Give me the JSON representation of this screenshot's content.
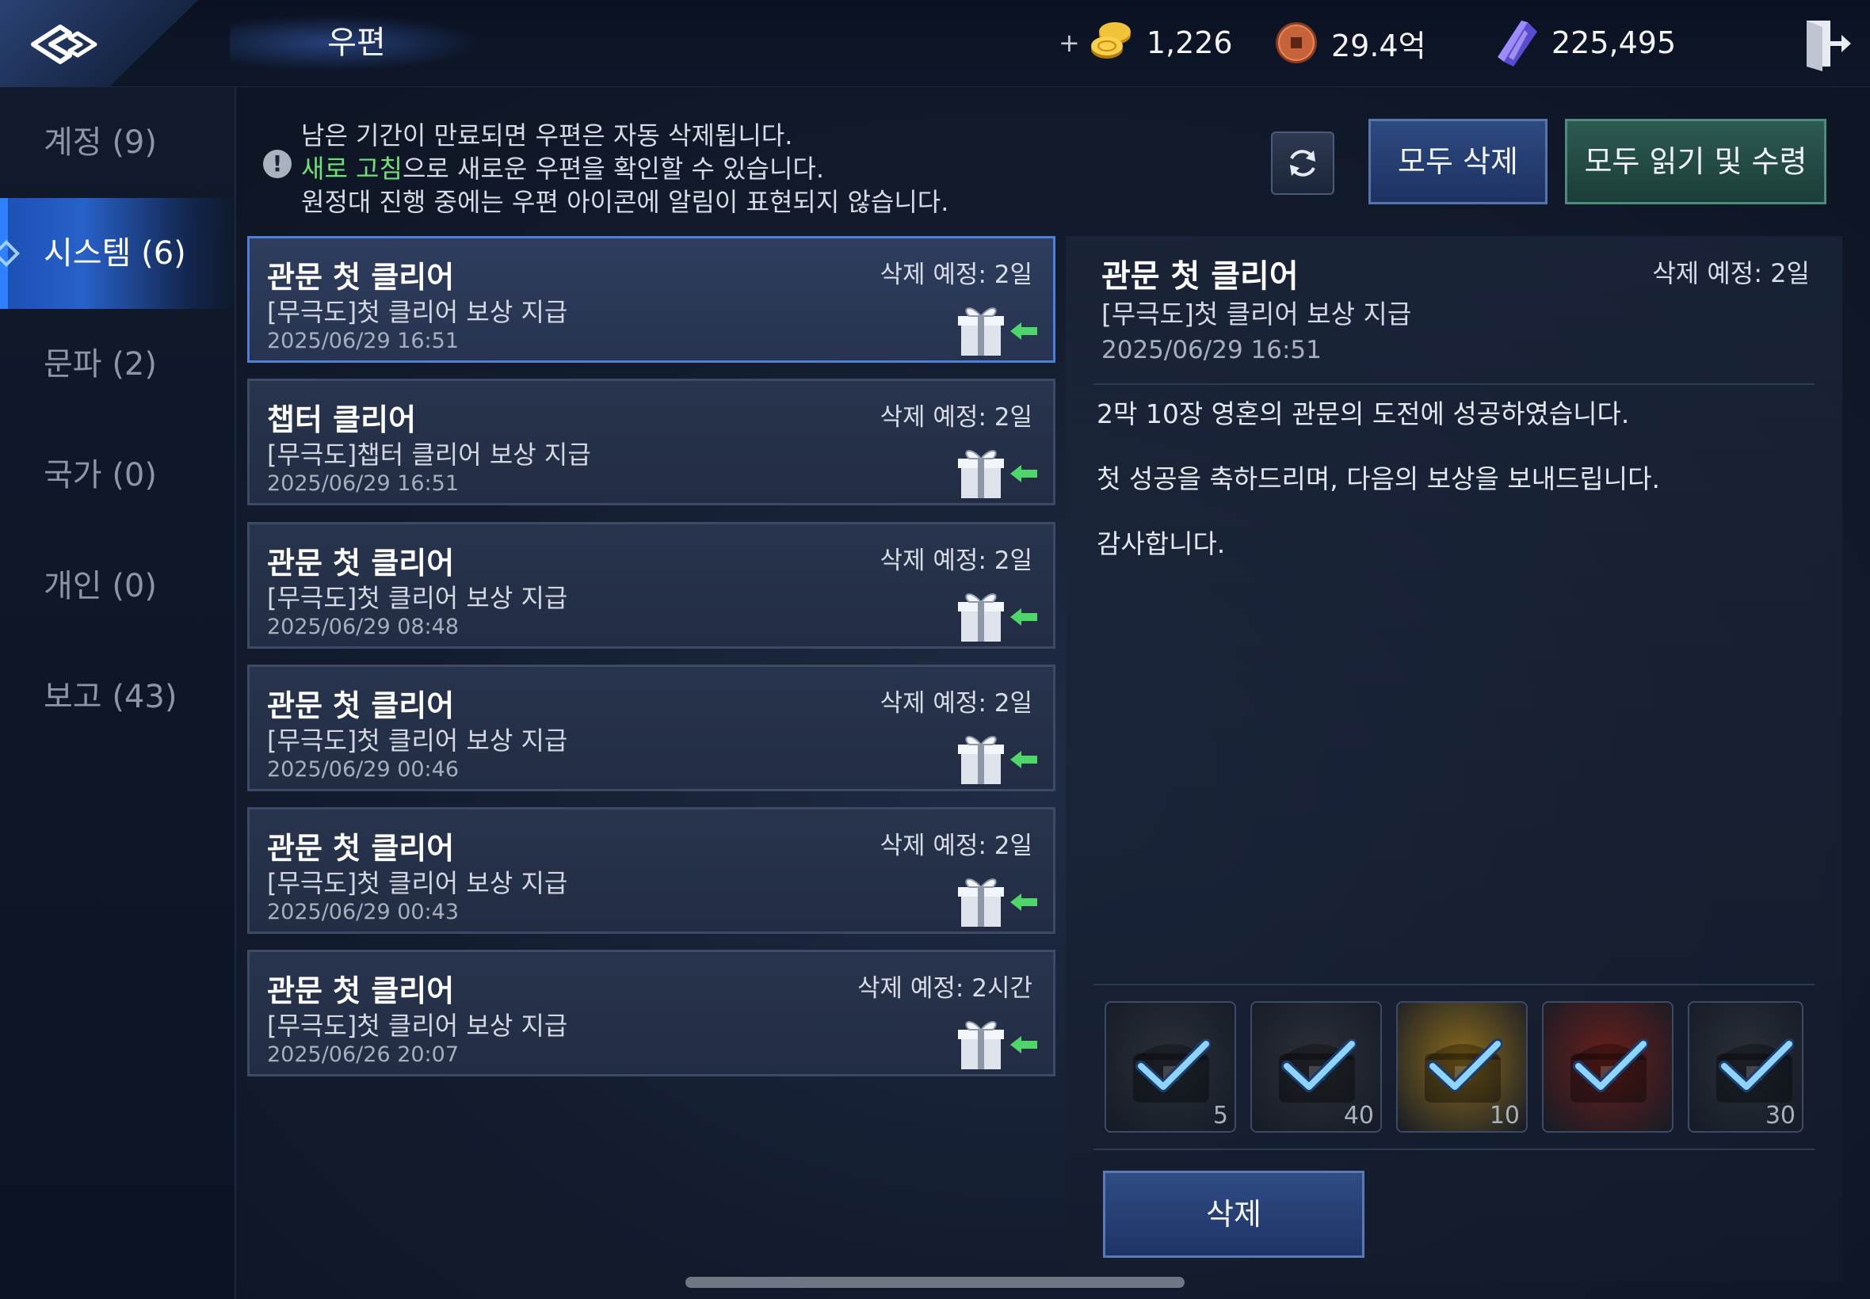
{
  "header": {
    "title": "우편",
    "currencies": [
      {
        "icon": "gold-coins-icon",
        "amount": "1,226",
        "has_plus": true
      },
      {
        "icon": "copper-coin-icon",
        "amount": "29.4억",
        "has_plus": false
      },
      {
        "icon": "purple-crystal-icon",
        "amount": "225,495",
        "has_plus": false
      }
    ]
  },
  "sidebar": {
    "items": [
      {
        "label": "계정 (9)",
        "active": false
      },
      {
        "label": "시스템 (6)",
        "active": true
      },
      {
        "label": "문파 (2)",
        "active": false
      },
      {
        "label": "국가 (0)",
        "active": false
      },
      {
        "label": "개인 (0)",
        "active": false
      },
      {
        "label": "보고 (43)",
        "active": false
      }
    ]
  },
  "notice": {
    "line1": "남은 기간이 만료되면 우편은 자동 삭제됩니다.",
    "line2_highlight": "새로 고침",
    "line2_rest": "으로 새로운 우편을 확인할 수 있습니다.",
    "line3": "원정대 진행 중에는 우편 아이콘에 알림이 표현되지 않습니다."
  },
  "toolbar": {
    "delete_all": "모두 삭제",
    "read_all": "모두 읽기 및 수령"
  },
  "mails": [
    {
      "title": "관문 첫 클리어",
      "subtitle": "[무극도]첫 클리어 보상 지급",
      "date": "2025/06/29 16:51",
      "expire": "삭제 예정: 2일",
      "selected": true
    },
    {
      "title": "챕터 클리어",
      "subtitle": "[무극도]챕터 클리어 보상 지급",
      "date": "2025/06/29 16:51",
      "expire": "삭제 예정: 2일",
      "selected": false
    },
    {
      "title": "관문 첫 클리어",
      "subtitle": "[무극도]첫 클리어 보상 지급",
      "date": "2025/06/29 08:48",
      "expire": "삭제 예정: 2일",
      "selected": false
    },
    {
      "title": "관문 첫 클리어",
      "subtitle": "[무극도]첫 클리어 보상 지급",
      "date": "2025/06/29 00:46",
      "expire": "삭제 예정: 2일",
      "selected": false
    },
    {
      "title": "관문 첫 클리어",
      "subtitle": "[무극도]첫 클리어 보상 지급",
      "date": "2025/06/29 00:43",
      "expire": "삭제 예정: 2일",
      "selected": false
    },
    {
      "title": "관문 첫 클리어",
      "subtitle": "[무극도]첫 클리어 보상 지급",
      "date": "2025/06/26 20:07",
      "expire": "삭제 예정: 2시간",
      "selected": false
    }
  ],
  "detail": {
    "title": "관문 첫 클리어",
    "expire": "삭제 예정: 2일",
    "subtitle": "[무극도]첫 클리어 보상 지급",
    "date": "2025/06/29 16:51",
    "body": [
      "2막 10장 영혼의 관문의 도전에 성공하였습니다.",
      "첫 성공을 축하드리며, 다음의 보상을 보내드립니다.",
      "감사합니다."
    ],
    "rewards": [
      {
        "icon": "dark-coin-bag-icon",
        "count": "5",
        "claimed": true,
        "bg": "#2a2f38"
      },
      {
        "icon": "wooden-chest-icon",
        "count": "40",
        "claimed": true,
        "bg": "#2c2f36"
      },
      {
        "icon": "golden-chest-icon",
        "count": "10",
        "claimed": true,
        "bg": "#8a6a1c"
      },
      {
        "icon": "red-chest-icon",
        "count": "",
        "claimed": true,
        "bg": "#6a1f1a"
      },
      {
        "icon": "orb-scroll-icon",
        "count": "30",
        "claimed": true,
        "bg": "#2a2f38"
      }
    ],
    "delete_label": "삭제"
  },
  "colors": {
    "accent_blue": "#2861c9",
    "highlight_green": "#6fe07a",
    "claim_check": "#8fd3ff"
  }
}
